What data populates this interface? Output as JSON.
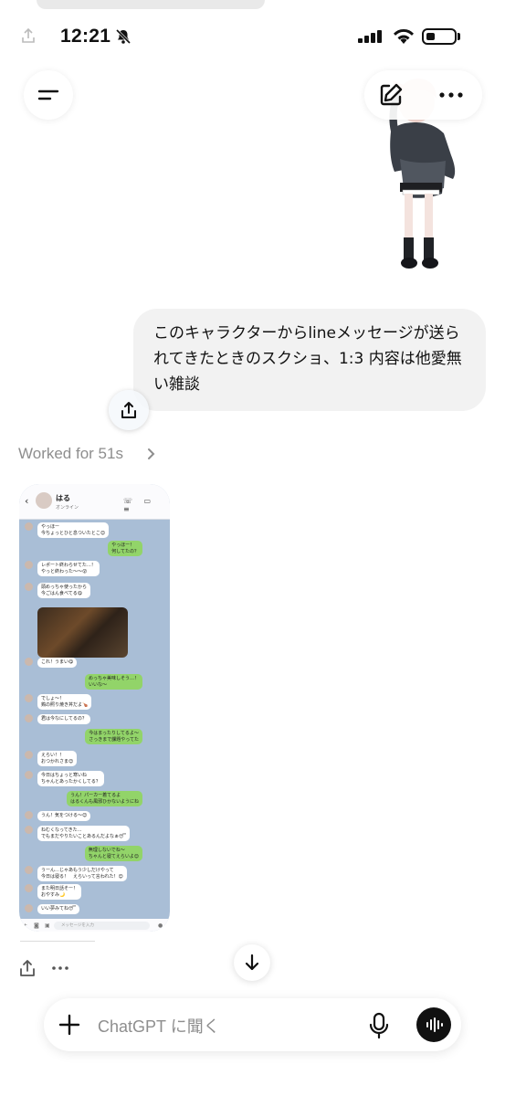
{
  "status_bar": {
    "time": "12:21"
  },
  "user_message": {
    "text": "このキャラクターからlineメッセージが送られてきたときのスクショ、1:3 内容は他愛無い雑談"
  },
  "assistant": {
    "worked_label": "Worked for 51s"
  },
  "generated_image": {
    "contact_name": "はる",
    "contact_status": "オンライン",
    "input_placeholder": "メッセージを入力",
    "messages": [
      {
        "side": "left",
        "text": "やっほー\n今ちょっとひと息ついたとこ😊"
      },
      {
        "side": "right",
        "text": "やっほー！\n何してたの？"
      },
      {
        "side": "left",
        "text": "レポート終わらせてた…！\nやっと終わった〜〜😮"
      },
      {
        "side": "left",
        "text": "頭めっちゃ使ったから\n今ごはん食べてる😋"
      },
      {
        "side": "left",
        "text": "これ！うまい😋"
      },
      {
        "side": "right",
        "text": "めっちゃ美味しそう…！\nいいな〜"
      },
      {
        "side": "left",
        "text": "でしょ〜！\n鶏の照り焼き丼だよ🍗"
      },
      {
        "side": "left",
        "text": "君は今なにしてるの？"
      },
      {
        "side": "right",
        "text": "今はまったりしてるよ〜\nさっきまで課題やってた"
      },
      {
        "side": "left",
        "text": "えらい！！\nおつかれさま😊"
      },
      {
        "side": "left",
        "text": "今日はちょっと寒いね\nちゃんとあったかくしてる？"
      },
      {
        "side": "right",
        "text": "うん！パーカー着てるよ\nはるくんも風邪ひかないようにね"
      },
      {
        "side": "left",
        "text": "うん！気をつける〜😊"
      },
      {
        "side": "left",
        "text": "ねむくなってきた…\nでもまだやりたいことあるんだよなぁ😴"
      },
      {
        "side": "right",
        "text": "無理しないでね〜\nちゃんと寝てえらいよ😊"
      },
      {
        "side": "left",
        "text": "うーん…じゃあもう少しだけやって\n今日は寝る！　えらいって言われた！😊"
      },
      {
        "side": "left",
        "text": "また明日話そー！\nおやすみ🌙"
      },
      {
        "side": "left",
        "text": "いい夢みてね😴"
      }
    ]
  },
  "composer": {
    "placeholder": "ChatGPT に聞く"
  },
  "icons": [
    "menu-icon",
    "edit-icon",
    "more-icon",
    "share-icon",
    "chevron-right-icon",
    "arrow-down-icon",
    "plus-icon",
    "mic-icon",
    "voice-icon",
    "bell-off-icon",
    "signal-icon",
    "wifi-icon",
    "battery-icon"
  ],
  "colors": {
    "line_bg": "#a9bed6",
    "line_green": "#92d469",
    "bubble_gray": "#f2f2f2",
    "voice_button": "#111111"
  }
}
